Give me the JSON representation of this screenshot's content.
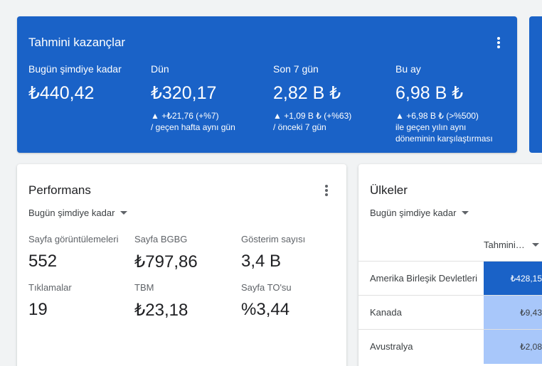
{
  "earnings": {
    "title": "Tahmini kazançlar",
    "columns": [
      {
        "label": "Bugün şimdiye kadar",
        "value": "₺440,42",
        "delta": "",
        "compare": "",
        "compare2": ""
      },
      {
        "label": "Dün",
        "value": "₺320,17",
        "delta": "▲ +₺21,76 (+%7)",
        "compare": "/ geçen hafta aynı gün",
        "compare2": ""
      },
      {
        "label": "Son 7 gün",
        "value": "2,82 B ₺",
        "delta": "▲ +1,09 B ₺ (+%63)",
        "compare": "/ önceki 7 gün",
        "compare2": ""
      },
      {
        "label": "Bu ay",
        "value": "6,98 B ₺",
        "delta": "▲ +6,98 B ₺ (>%500)",
        "compare": "ile geçen yılın aynı",
        "compare2": "döneminin karşılaştırması"
      }
    ]
  },
  "performance": {
    "title": "Performans",
    "range": "Bugün şimdiye kadar",
    "metrics": [
      {
        "label": "Sayfa görüntülemeleri",
        "value": "552"
      },
      {
        "label": "Sayfa BGBG",
        "value": "₺797,86"
      },
      {
        "label": "Gösterim sayısı",
        "value": "3,4 B"
      },
      {
        "label": "Tıklamalar",
        "value": "19"
      },
      {
        "label": "TBM",
        "value": "₺23,18"
      },
      {
        "label": "Sayfa TO'su",
        "value": "%3,44"
      }
    ]
  },
  "countries": {
    "title": "Ülkeler",
    "range": "Bugün şimdiye kadar",
    "column_header": "Tahmini…",
    "rows": [
      {
        "name": "Amerika Birleşik Devletleri",
        "value": "₺428,15"
      },
      {
        "name": "Kanada",
        "value": "₺9,43"
      },
      {
        "name": "Avustralya",
        "value": "₺2,08"
      }
    ]
  },
  "colors": {
    "brand_blue": "#1a62c7",
    "bar_light": "#a8c7fa"
  }
}
